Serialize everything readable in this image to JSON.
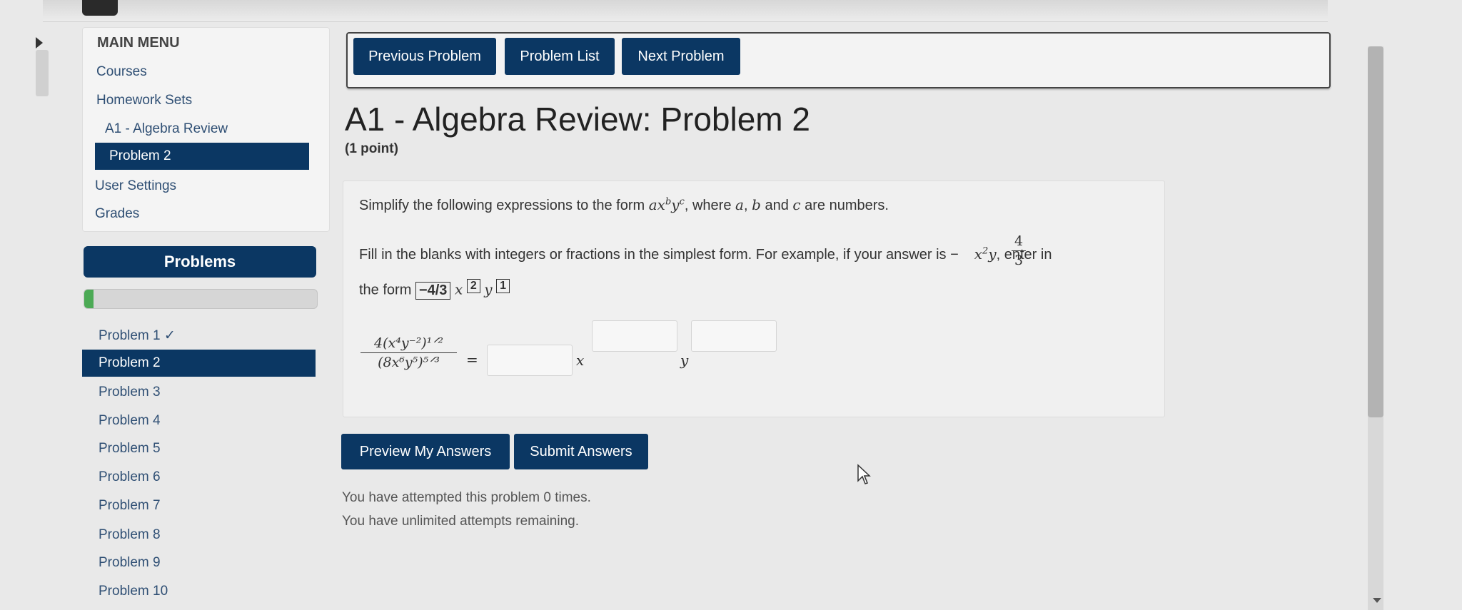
{
  "main_menu": {
    "header": "MAIN MENU",
    "courses": "Courses",
    "homework_sets": "Homework Sets",
    "set_name": "A1 - Algebra Review",
    "current_problem": "Problem 2",
    "user_settings": "User Settings",
    "grades": "Grades"
  },
  "problems_panel": {
    "title": "Problems",
    "progress_fraction": 0.04,
    "items": [
      "Problem 1 ✓",
      "Problem 2",
      "Problem 3",
      "Problem 4",
      "Problem 5",
      "Problem 6",
      "Problem 7",
      "Problem 8",
      "Problem 9",
      "Problem 10"
    ]
  },
  "nav": {
    "previous": "Previous Problem",
    "list": "Problem List",
    "next": "Next Problem"
  },
  "page": {
    "title": "A1 - Algebra Review: Problem 2",
    "points": "(1 point)"
  },
  "problem": {
    "line1_prefix": "Simplify the following expressions to the form ",
    "line1_form": "ax",
    "line1_b": "b",
    "line1_y": "y",
    "line1_c": "c",
    "line1_suffix": ", where ",
    "var_a": "a",
    "comma": ", ",
    "var_b": "b",
    "and": " and ",
    "var_c": "c",
    "line1_end": " are numbers.",
    "line2_prefix": "Fill in the blanks with integers or fractions in the simplest form. For example, if your answer is −",
    "example_num": "4",
    "example_den": "3",
    "example_tail": "x",
    "example_exp": "2",
    "example_y": "y",
    "line2_suffix": ", enter in",
    "line3_prefix": "the form ",
    "box1": "−4/3",
    "x_var": "x",
    "box2": "2",
    "y_var": "y",
    "box3": "1",
    "expr_num": "4(x⁴y⁻²)¹ᐟ²",
    "expr_den": "(8x⁶y⁵)⁵ᐟ³",
    "equals": "=",
    "ans_x": "x",
    "ans_y": "y"
  },
  "actions": {
    "preview": "Preview My Answers",
    "submit": "Submit Answers"
  },
  "status": {
    "attempts": "You have attempted this problem 0 times.",
    "remaining": "You have unlimited attempts remaining."
  },
  "colors": {
    "primary": "#0b3763",
    "progress": "#4caa55"
  }
}
